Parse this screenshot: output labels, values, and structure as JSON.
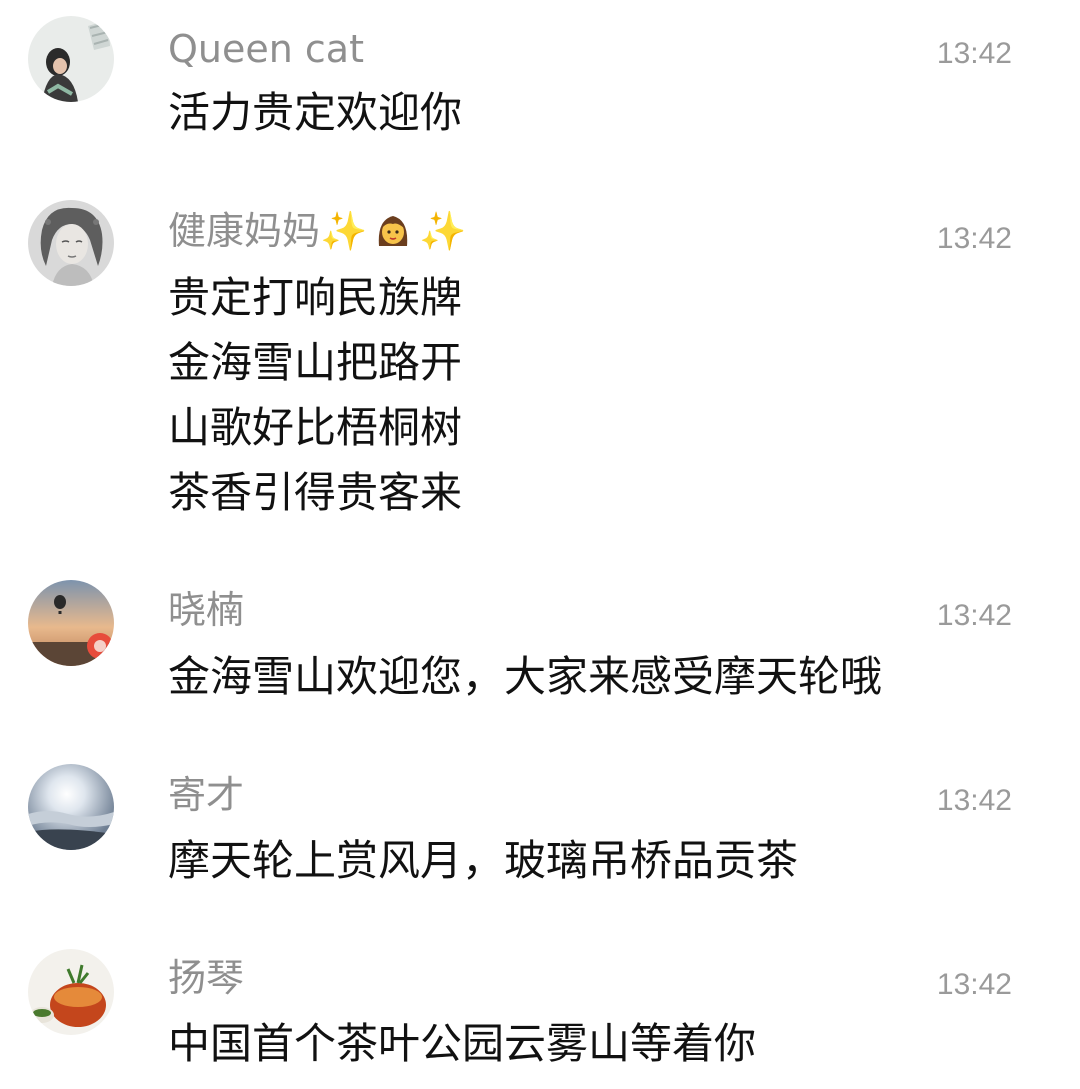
{
  "comments": [
    {
      "author": "Queen cat",
      "time": "13:42",
      "lines": [
        "活力贵定欢迎你"
      ],
      "avatar_icon": "woman-portrait-avatar"
    },
    {
      "author": "健康妈妈",
      "author_emoji": [
        "sparkles",
        "woman",
        "sparkles"
      ],
      "time": "13:42",
      "lines": [
        "贵定打响民族牌",
        "金海雪山把路开",
        "山歌好比梧桐树",
        "茶香引得贵客来"
      ],
      "avatar_icon": "sketch-portrait-avatar"
    },
    {
      "author": "晓楠",
      "time": "13:42",
      "lines": [
        "金海雪山欢迎您，大家来感受摩天轮哦"
      ],
      "avatar_icon": "hot-air-balloon-avatar"
    },
    {
      "author": "寄才",
      "time": "13:42",
      "lines": [
        "摩天轮上赏风月，玻璃吊桥品贡茶"
      ],
      "avatar_icon": "sunrise-clouds-avatar"
    },
    {
      "author": "扬琴",
      "time": "13:42",
      "lines": [
        "中国首个茶叶公园云雾山等着你"
      ],
      "avatar_icon": "tea-cup-avatar"
    }
  ],
  "colors": {
    "author": "#8f8f8f",
    "time": "#9a9a9a",
    "text": "#111111"
  }
}
